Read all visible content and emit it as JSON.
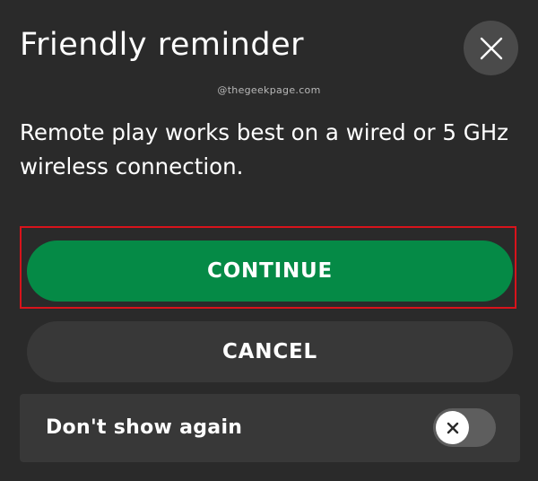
{
  "dialog": {
    "title": "Friendly reminder",
    "message": "Remote play works best on a wired or 5 GHz wireless connection.",
    "watermark": "@thegeekpage.com",
    "close_icon": "close-icon"
  },
  "buttons": {
    "continue_label": "CONTINUE",
    "cancel_label": "CANCEL"
  },
  "dont_show_again": {
    "label": "Don't show again",
    "enabled": false,
    "knob_icon": "x-icon"
  },
  "colors": {
    "background": "#2a2a2a",
    "continue_button": "#058a46",
    "secondary_surface": "#383838",
    "highlight_border": "#d8131b",
    "toggle_track": "#5e5e5e"
  }
}
